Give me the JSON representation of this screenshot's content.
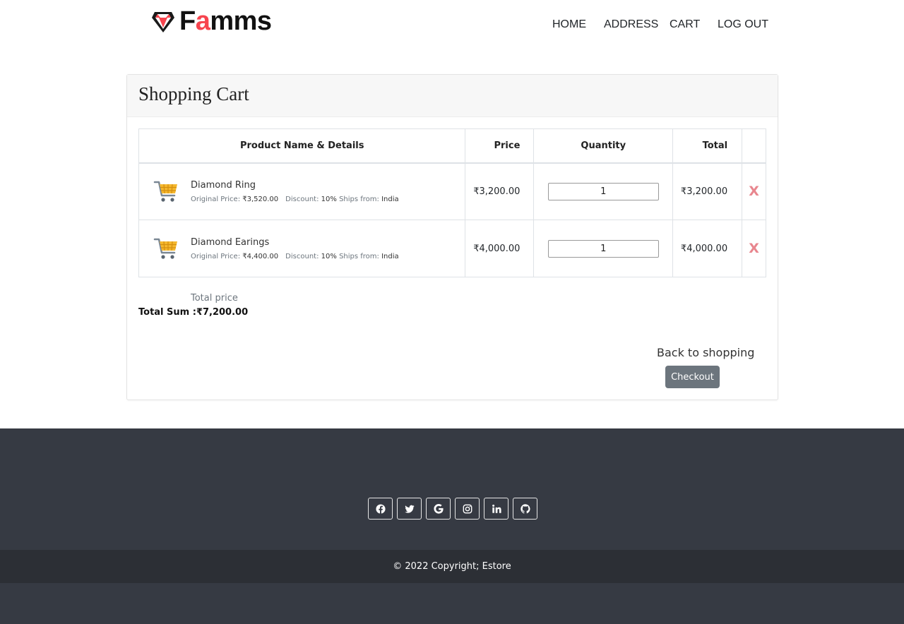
{
  "brand": {
    "name_prefix": "F",
    "name_accent": "a",
    "name_suffix": "mms",
    "accent_color": "#f7444e"
  },
  "nav": {
    "items": [
      "HOME",
      "ADDRESS",
      "CART",
      "LOG OUT"
    ]
  },
  "cart": {
    "title": "Shopping Cart",
    "headers": {
      "name": "Product Name & Details",
      "price": "Price",
      "quantity": "Quantity",
      "total": "Total"
    },
    "items": [
      {
        "name": "Diamond Ring",
        "original_label": "Original Price:",
        "original_price": "₹3,520.00",
        "discount_label": "Discount:",
        "discount": "10%",
        "ships_label": "Ships from:",
        "ships_from": "India",
        "price": "₹3,200.00",
        "quantity": "1",
        "total": "₹3,200.00",
        "remove": "X"
      },
      {
        "name": "Diamond Earings",
        "original_label": "Original Price:",
        "original_price": "₹4,400.00",
        "discount_label": "Discount:",
        "discount": "10%",
        "ships_label": "Ships from:",
        "ships_from": "India",
        "price": "₹4,000.00",
        "quantity": "1",
        "total": "₹4,000.00",
        "remove": "X"
      }
    ],
    "total_price_label": "Total price",
    "total_sum_label": "Total Sum :",
    "total_sum": "₹7,200.00",
    "back_label": "Back to shopping",
    "checkout_label": "Checkout"
  },
  "footer": {
    "social_icons": [
      "facebook-icon",
      "twitter-icon",
      "google-icon",
      "instagram-icon",
      "linkedin-icon",
      "github-icon"
    ],
    "copyright": "© 2022 Copyright; Estore",
    "bg_color": "#363a43"
  }
}
